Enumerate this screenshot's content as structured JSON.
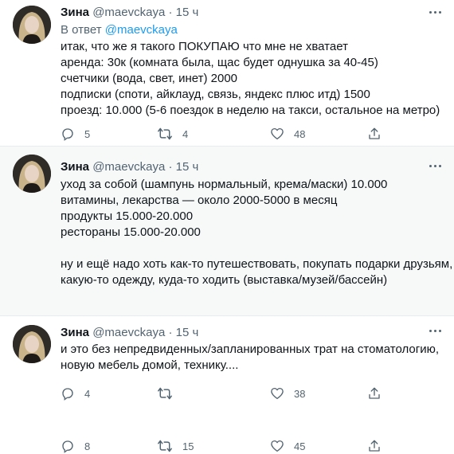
{
  "colors": {
    "accent": "#1d9bf0",
    "secondary_text": "#536471",
    "highlight_bg": "#f7f9f9"
  },
  "tweets": [
    {
      "name": "Зина",
      "handle": "@maevckaya",
      "separator": "·",
      "time": "15 ч",
      "reply_prefix": "В ответ",
      "reply_handle": "@maevckaya",
      "lines": [
        "итак, что же я такого ПОКУПАЮ что мне не хватает",
        "аренда: 30к (комната была, щас будет однушка за 40-45)",
        "счетчики (вода, свет, инет) 2000",
        "подписки (споти, айклауд, связь, яндекс плюс итд) 1500",
        "проезд: 10.000 (5-6 поездок в неделю на такси, остальное на метро)"
      ],
      "replies": "5",
      "retweets": "4",
      "likes": "48"
    },
    {
      "name": "Зина",
      "handle": "@maevckaya",
      "separator": "·",
      "time": "15 ч",
      "lines": [
        "уход за собой (шампунь нормальный, крема/маски) 10.000",
        "витамины, лекарства — около 2000-5000 в месяц",
        "продукты 15.000-20.000",
        "рестораны 15.000-20.000",
        "",
        "ну и ещё надо хоть как-то путешествовать, покупать подарки друзьям,",
        "какую-то одежду, куда-то ходить (выставка/музей/бассейн)"
      ],
      "replies": "8",
      "retweets": "15",
      "likes": "45"
    },
    {
      "name": "Зина",
      "handle": "@maevckaya",
      "separator": "·",
      "time": "15 ч",
      "lines": [
        "и это без непредвиденных/запланированных трат на стоматологию,",
        "новую мебель домой, технику...."
      ],
      "replies": "4",
      "retweets": "",
      "likes": "38"
    }
  ]
}
